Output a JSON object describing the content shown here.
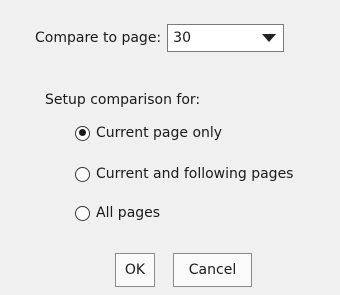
{
  "compare": {
    "label": "Compare to page:",
    "selected_page": "30"
  },
  "setup": {
    "label": "Setup comparison for:",
    "options": [
      {
        "label": "Current page only",
        "checked": true
      },
      {
        "label": "Current and following pages",
        "checked": false
      },
      {
        "label": "All pages",
        "checked": false
      }
    ]
  },
  "buttons": {
    "ok": "OK",
    "cancel": "Cancel"
  }
}
